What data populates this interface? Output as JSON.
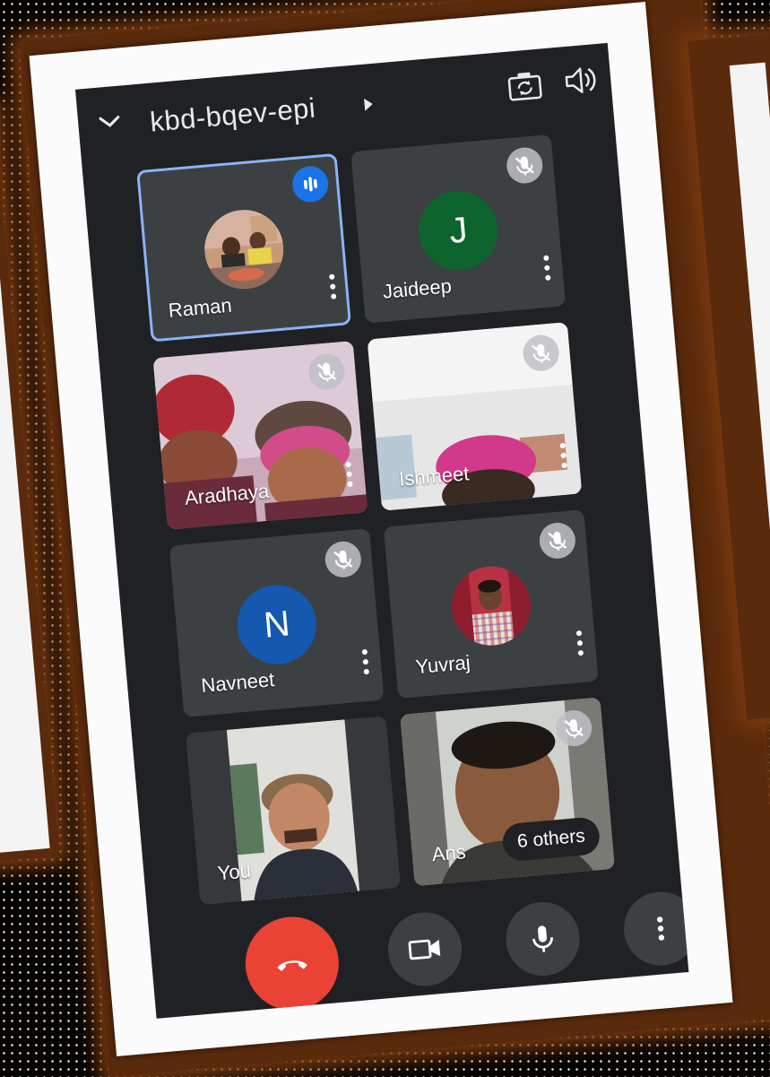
{
  "meeting": {
    "code": "kbd-bqev-epi"
  },
  "icons": {
    "collapse": "chevron-down-icon",
    "camera_switch": "camera-flip-icon",
    "audio_output": "speaker-icon"
  },
  "participants": [
    {
      "name": "Raman",
      "speaking": true,
      "muted": false,
      "avatar": "photo"
    },
    {
      "name": "Jaideep",
      "speaking": false,
      "muted": true,
      "avatar_letter": "J",
      "avatar_color": "#0d652d"
    },
    {
      "name": "Aradhaya",
      "speaking": false,
      "muted": true,
      "avatar": "video"
    },
    {
      "name": "Ishmeet",
      "speaking": false,
      "muted": true,
      "avatar": "video"
    },
    {
      "name": "Navneet",
      "speaking": false,
      "muted": true,
      "avatar_letter": "N",
      "avatar_color": "#1558b0"
    },
    {
      "name": "Yuvraj",
      "speaking": false,
      "muted": true,
      "avatar": "photo"
    },
    {
      "name": "You",
      "speaking": false,
      "muted": false,
      "avatar": "video"
    },
    {
      "name": "Ans",
      "speaking": false,
      "muted": true,
      "avatar": "video"
    }
  ],
  "overflow": {
    "label": "6 others"
  },
  "controls": {
    "end_call_color": "#ea4335",
    "button_bg": "#3c4043"
  },
  "colors": {
    "screen_bg": "#202124",
    "tile_bg": "#3c4043",
    "active_border": "#8ab4f8",
    "speaking_badge": "#1a73e8"
  }
}
